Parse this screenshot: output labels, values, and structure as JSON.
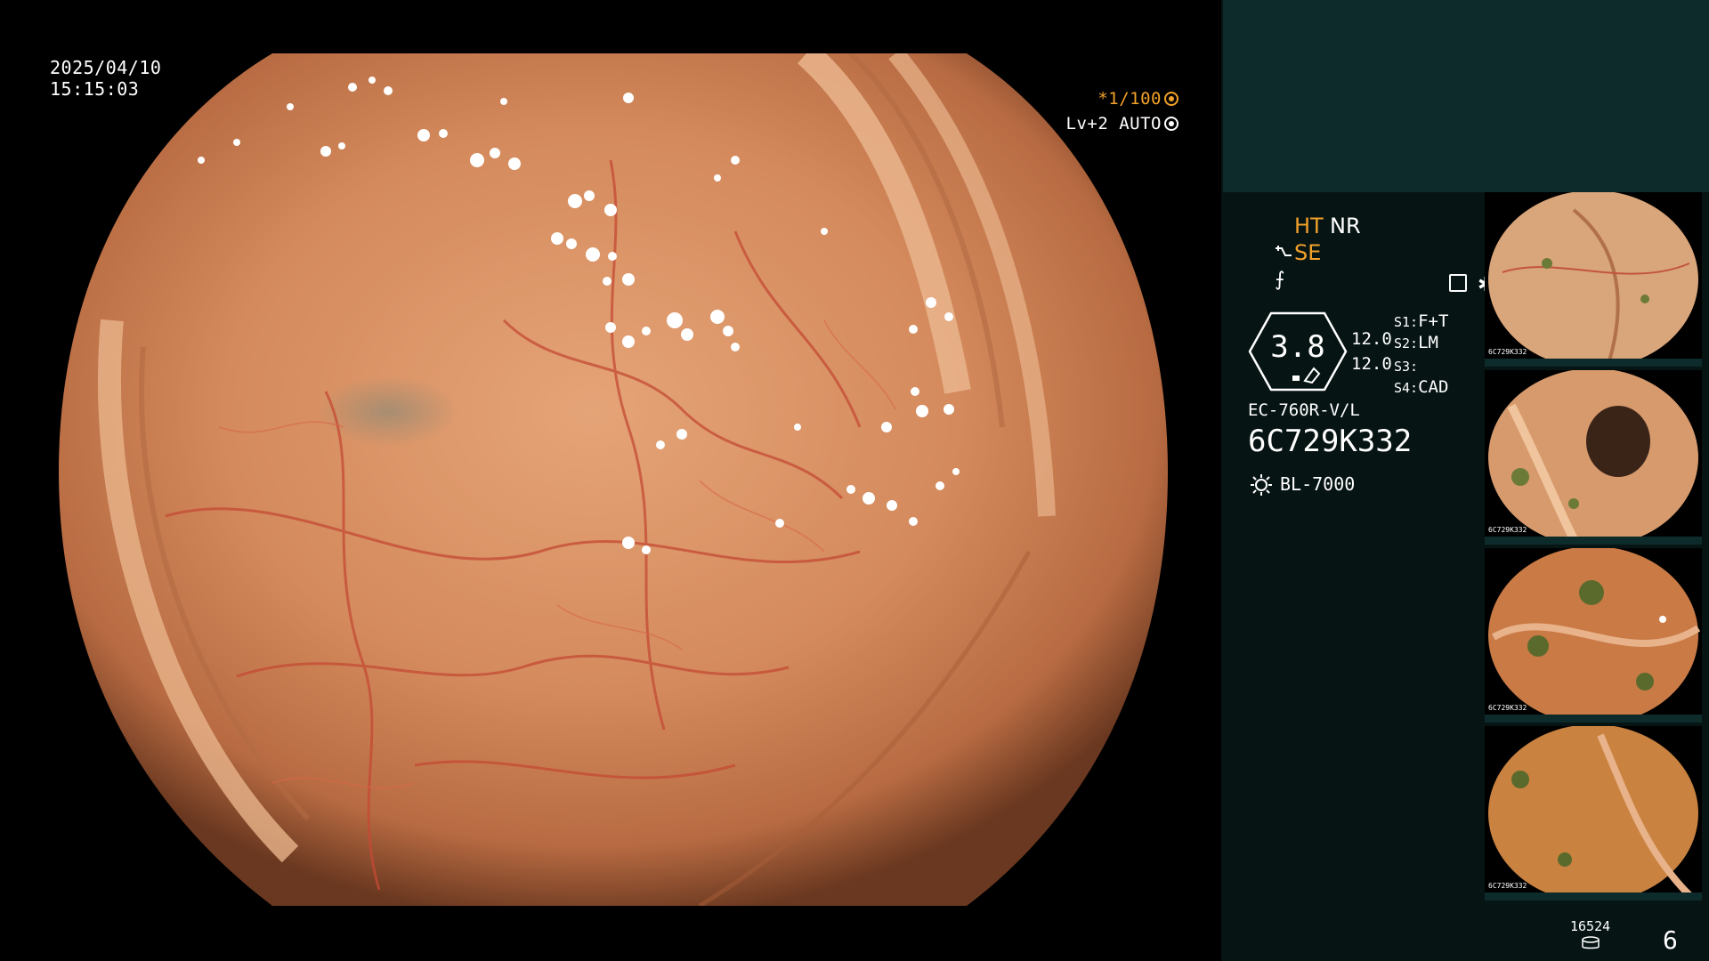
{
  "overlay": {
    "date": "2025/04/10",
    "time": "15:15:03",
    "shutter": "*1/100",
    "level_auto": "Lv+2 AUTO"
  },
  "panel": {
    "ht": "HT",
    "nr": "NR",
    "se": "SE",
    "gauge_value": "3.8",
    "gauge_r1": "12.0",
    "gauge_r2": "12.0",
    "s1_key": "S1:",
    "s1_val": "F+T",
    "s2_key": "S2:",
    "s2_val": "LM",
    "s3_key": "S3:",
    "s3_val": "",
    "s4_key": "S4:",
    "s4_val": "CAD",
    "model": "EC-760R-V/L",
    "serial": "6C729K332",
    "light_source": "BL-7000",
    "storage_count": "16524",
    "page": "6"
  },
  "thumbnails": [
    {
      "label": "6C729K332"
    },
    {
      "label": "6C729K332"
    },
    {
      "label": "6C729K332"
    },
    {
      "label": "6C729K332"
    }
  ],
  "colors": {
    "accent_orange": "#f2a12a",
    "panel_bg": "#071414",
    "panel_top": "#0e2b2b"
  },
  "icons": [
    "shutter-icon",
    "auto-icon",
    "structure-enhance-icon",
    "freeze-icon",
    "menu-icon",
    "star-icon",
    "light-source-icon",
    "storage-icon"
  ]
}
